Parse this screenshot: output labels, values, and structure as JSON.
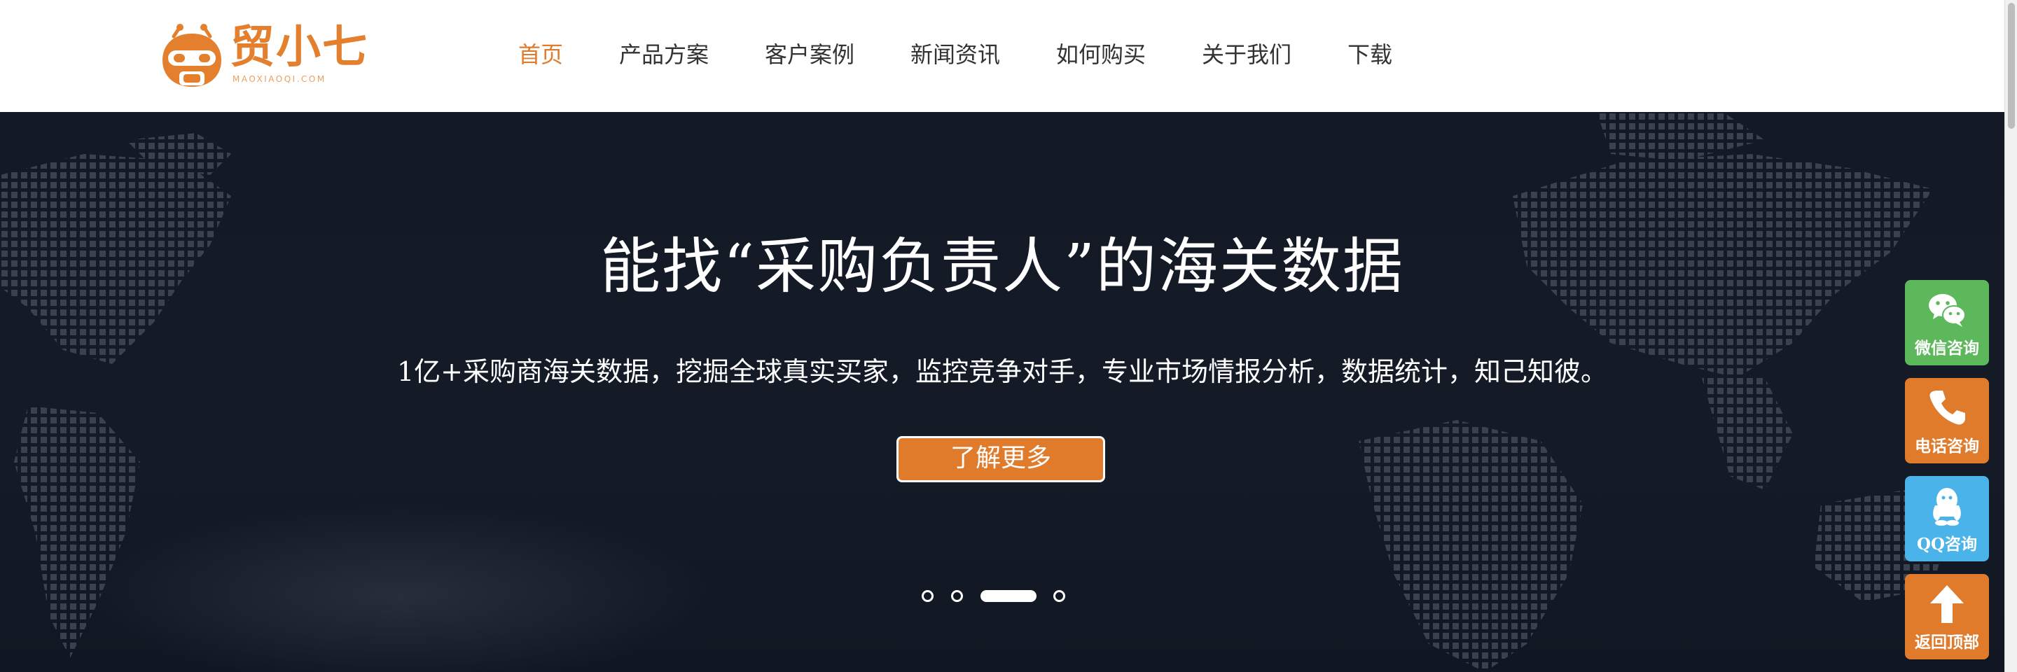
{
  "brand": {
    "name": "贸小七",
    "domain": "MAOXIAOQI.COM",
    "color": "#e47f2e"
  },
  "nav": {
    "items": [
      {
        "label": "首页",
        "active": true
      },
      {
        "label": "产品方案",
        "active": false
      },
      {
        "label": "客户案例",
        "active": false
      },
      {
        "label": "新闻资讯",
        "active": false
      },
      {
        "label": "如何购买",
        "active": false
      },
      {
        "label": "关于我们",
        "active": false
      },
      {
        "label": "下载",
        "active": false
      }
    ],
    "active_color": "#e17b2c"
  },
  "hero": {
    "title": "能找“采购负责人”的海关数据",
    "subtitle": "1亿+采购商海关数据，挖掘全球真实买家，监控竞争对手，专业市场情报分析，数据统计，知己知彼。",
    "cta_label": "了解更多",
    "slides": {
      "count": 4,
      "active_index": 3
    }
  },
  "side_buttons": [
    {
      "label": "微信咨询",
      "icon": "wechat-icon",
      "color": "#5db85c"
    },
    {
      "label": "电话咨询",
      "icon": "phone-icon",
      "color": "#e17b2c"
    },
    {
      "label": "QQ咨询",
      "icon": "qq-icon",
      "color": "#4ab3ea"
    },
    {
      "label": "返回顶部",
      "icon": "arrow-up-icon",
      "color": "#e17b2c"
    }
  ]
}
